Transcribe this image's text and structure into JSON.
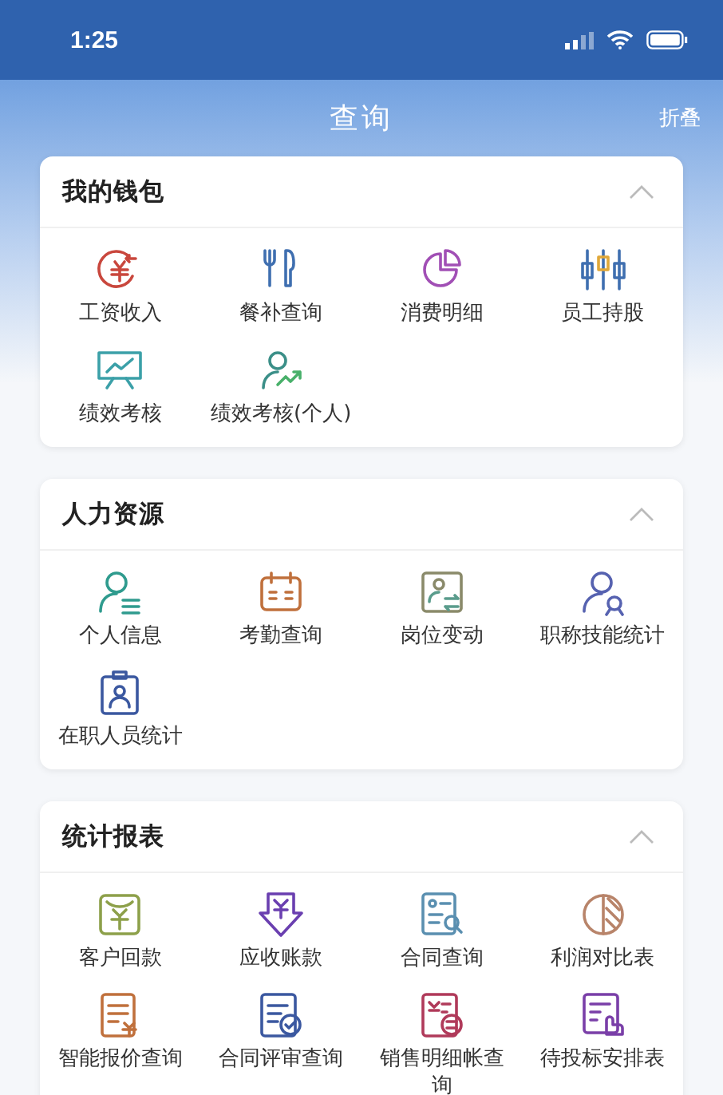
{
  "status_bar": {
    "time": "1:25"
  },
  "header": {
    "title": "查询",
    "action": "折叠"
  },
  "sections": [
    {
      "title": "我的钱包",
      "expanded": true,
      "items": [
        "工资收入",
        "餐补查询",
        "消费明细",
        "员工持股",
        "绩效考核",
        "绩效考核(个人)"
      ]
    },
    {
      "title": "人力资源",
      "expanded": true,
      "items": [
        "个人信息",
        "考勤查询",
        "岗位变动",
        "职称技能统计",
        "在职人员统计"
      ]
    },
    {
      "title": "统计报表",
      "expanded": true,
      "items": [
        "客户回款",
        "应收账款",
        "合同查询",
        "利润对比表",
        "智能报价查询",
        "合同评审查询",
        "销售明细帐查询",
        "待投标安排表"
      ]
    }
  ]
}
